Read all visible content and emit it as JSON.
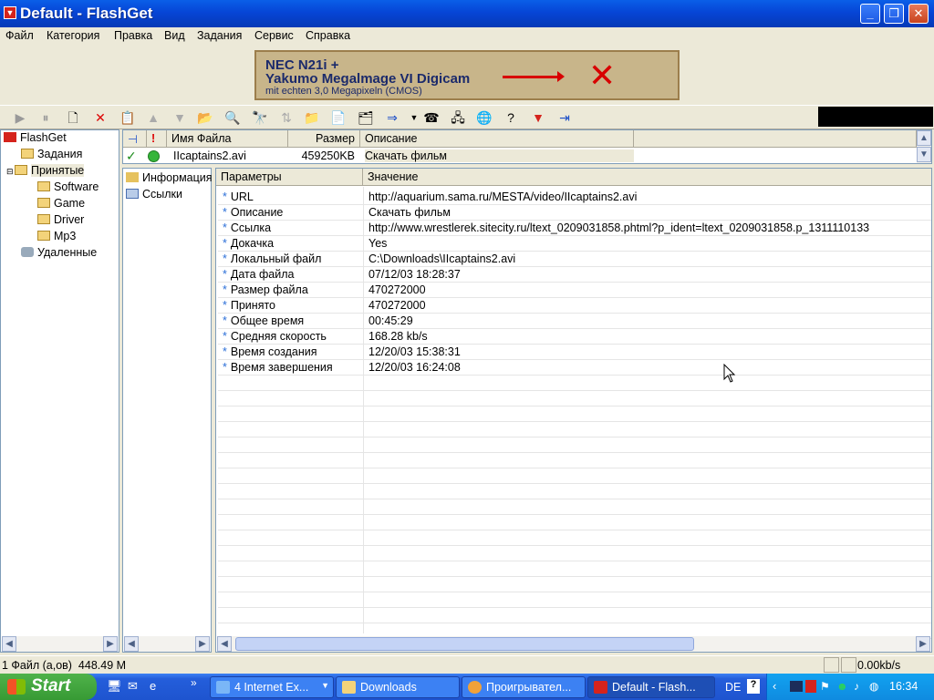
{
  "window": {
    "title": "Default - FlashGet"
  },
  "menu": [
    "Файл",
    "Категория",
    "Правка",
    "Вид",
    "Задания",
    "Сервис",
    "Справка"
  ],
  "banner": {
    "line1": "NEC N21i +",
    "line2": "Yakumo Megalmage VI Digicam",
    "line3": "mit echten 3,0 Megapixeln (CMOS)"
  },
  "tree": {
    "root": "FlashGet",
    "items": [
      "Задания",
      "Принятые",
      "Software",
      "Game",
      "Driver",
      "Mp3",
      "Удаленные"
    ]
  },
  "download_list": {
    "columns": [
      "Имя Файла",
      "Размер",
      "Описание"
    ],
    "row": {
      "name": "IIcaptains2.avi",
      "size": "459250KB",
      "description": "Скачать фильм"
    }
  },
  "info_tabs": [
    "Информация",
    "Ссылки"
  ],
  "properties": {
    "columns": [
      "Параметры",
      "Значение"
    ],
    "rows": [
      {
        "key": "URL",
        "value": "http://aquarium.sama.ru/MESTA/video/IIcaptains2.avi"
      },
      {
        "key": "Описание",
        "value": "Скачать фильм"
      },
      {
        "key": "Ссылка",
        "value": "http://www.wrestlerek.sitecity.ru/ltext_0209031858.phtml?p_ident=ltext_0209031858.p_1311110133"
      },
      {
        "key": "Докачка",
        "value": "Yes"
      },
      {
        "key": "Локальный файл",
        "value": "C:\\Downloads\\IIcaptains2.avi"
      },
      {
        "key": "Дата файла",
        "value": "07/12/03 18:28:37"
      },
      {
        "key": "Размер файла",
        "value": "470272000"
      },
      {
        "key": "Принято",
        "value": "470272000"
      },
      {
        "key": "Общее время",
        "value": "00:45:29"
      },
      {
        "key": "Средняя скорость",
        "value": "168.28 kb/s"
      },
      {
        "key": "Время создания",
        "value": "12/20/03 15:38:31"
      },
      {
        "key": "Время завершения",
        "value": "12/20/03 16:24:08"
      }
    ]
  },
  "status": {
    "left": "1 Файл (а,ов)  448.49 M",
    "speed": "0.00kb/s"
  },
  "taskbar": {
    "start": "Start",
    "tasks": [
      "4 Internet Ex...",
      "Downloads",
      "Проигрывател...",
      "Default - Flash..."
    ],
    "lang": "DE",
    "clock": "16:34"
  }
}
